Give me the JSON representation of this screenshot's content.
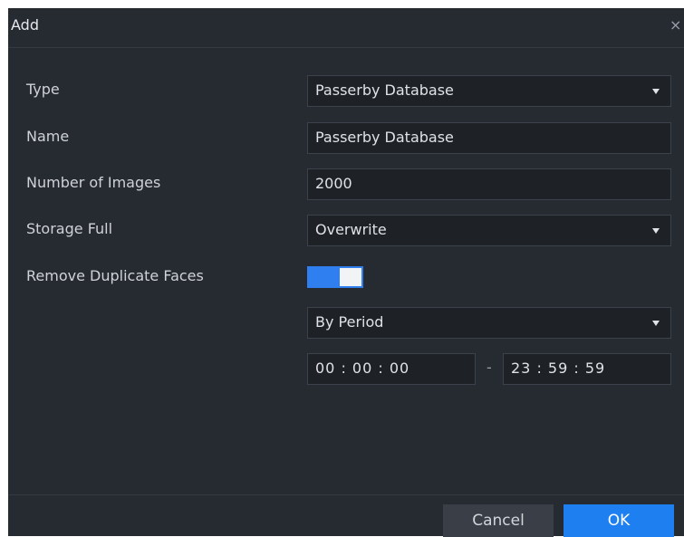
{
  "dialog": {
    "title": "Add",
    "close_glyph": "×"
  },
  "form": {
    "type_label": "Type",
    "type_value": "Passerby Database",
    "name_label": "Name",
    "name_value": "Passerby Database",
    "images_label": "Number of Images",
    "images_value": "2000",
    "storage_label": "Storage Full",
    "storage_value": "Overwrite",
    "dedupe_label": "Remove Duplicate Faces",
    "dedupe_enabled": true,
    "period_value": "By Period",
    "start_time": "00 : 00 : 00",
    "end_time": "23 : 59 : 59",
    "time_separator": "-"
  },
  "footer": {
    "cancel_label": "Cancel",
    "ok_label": "OK"
  },
  "colors": {
    "dialog_bg": "#262a31",
    "accent": "#1e7ff0"
  }
}
